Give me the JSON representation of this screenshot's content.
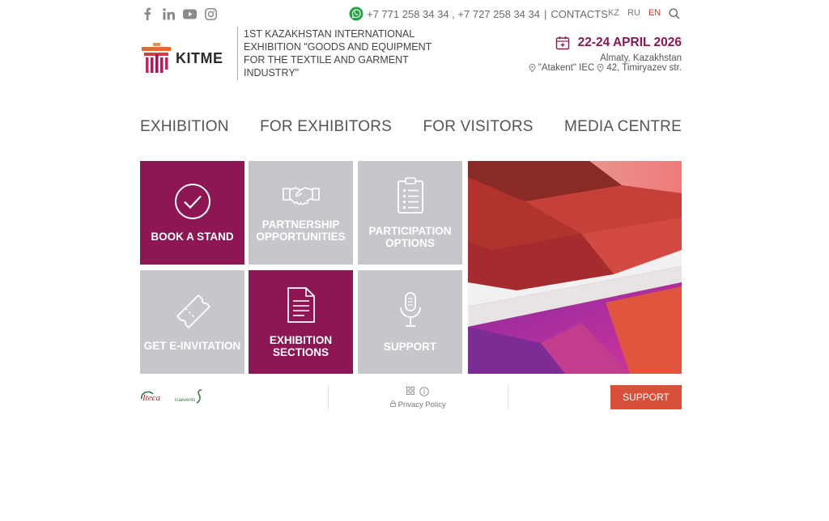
{
  "topbar": {
    "phones": "+7 771 258 34 34 , +7 727 258 34 34",
    "separator": "|",
    "contacts_label": "CONTACTS",
    "languages": [
      {
        "label": "KZ",
        "active": false
      },
      {
        "label": "RU",
        "active": false
      },
      {
        "label": "EN",
        "active": true
      }
    ],
    "social_icons": [
      "facebook-icon",
      "linkedin-icon",
      "youtube-icon",
      "instagram-icon"
    ]
  },
  "header": {
    "logo_text": "KITME",
    "tagline": "1ST KAZAKHSTAN INTERNATIONAL EXHIBITION \"GOODS AND EQUIPMENT FOR THE TEXTILE AND GARMENT INDUSTRY\"",
    "date": "22-24 APRIL 2026",
    "city": "Almaty, Kazakhstan",
    "venue": "\"Atakent\" IEC",
    "address": "42, Timiryazev str."
  },
  "nav": {
    "items": [
      "EXHIBITION",
      "FOR EXHIBITORS",
      "FOR VISITORS",
      "MEDIA CENTRE"
    ]
  },
  "tiles": [
    {
      "label": "BOOK A STAND",
      "icon": "checkmark-circle-icon",
      "color": "#8e1654"
    },
    {
      "label": "PARTNERSHIP OPPORTUNITIES",
      "icon": "handshake-icon",
      "color": "#c6c7cb"
    },
    {
      "label": "PARTICIPATION OPTIONS",
      "icon": "clipboard-icon",
      "color": "#c6c7cb"
    },
    {
      "label": "GET E-INVITATION",
      "icon": "ticket-icon",
      "color": "#c6c7cb"
    },
    {
      "label": "EXHIBITION SECTIONS",
      "icon": "document-icon",
      "color": "#8e1654"
    },
    {
      "label": "SUPPORT",
      "icon": "microphone-icon",
      "color": "#c6c7cb"
    }
  ],
  "footer": {
    "partner_1": "Iteca",
    "partner_2": "icaevents",
    "privacy_label": "Privacy Policy",
    "support_label": "SUPPORT"
  },
  "colors": {
    "brand": "#8e1654",
    "tile_grey": "#c6c7cb",
    "support_button": "#d8503a",
    "active_lang": "#c0392b"
  }
}
